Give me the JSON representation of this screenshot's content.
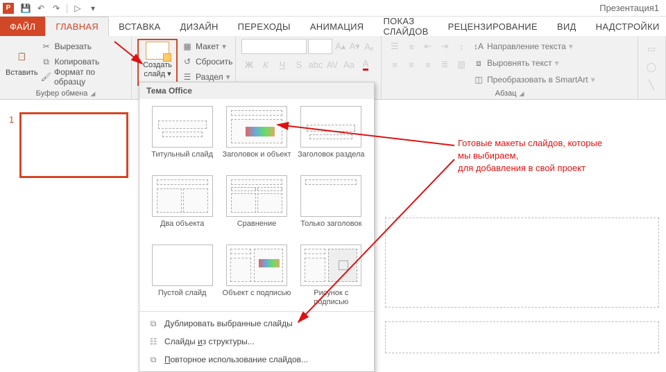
{
  "titlebar": {
    "doc_title": "Презентация1"
  },
  "tabs": {
    "file": "ФАЙЛ",
    "home": "ГЛАВНАЯ",
    "insert": "ВСТАВКА",
    "design": "ДИЗАЙН",
    "transitions": "ПЕРЕХОДЫ",
    "animation": "АНИМАЦИЯ",
    "slideshow": "ПОКАЗ СЛАЙДОВ",
    "review": "РЕЦЕНЗИРОВАНИЕ",
    "view": "ВИД",
    "addins": "НАДСТРОЙКИ"
  },
  "ribbon": {
    "clipboard": {
      "paste": "Вставить",
      "cut": "Вырезать",
      "copy": "Копировать",
      "format_painter": "Формат по образцу",
      "group_label": "Буфер обмена"
    },
    "slides": {
      "new_slide_line1": "Создать",
      "new_slide_line2": "слайд",
      "layout": "Макет",
      "reset": "Сбросить",
      "section": "Раздел"
    },
    "paragraph": {
      "group_label": "Абзац",
      "text_direction": "Направление текста",
      "align_text": "Выровнять текст",
      "convert_smartart": "Преобразовать в SmartArt"
    }
  },
  "dropdown": {
    "header": "Тема Office",
    "layouts": [
      "Титульный слайд",
      "Заголовок и объект",
      "Заголовок раздела",
      "Два объекта",
      "Сравнение",
      "Только заголовок",
      "Пустой слайд",
      "Объект с подписью",
      "Рисунок с подписью"
    ],
    "footer": {
      "duplicate": "Дублировать выбранные слайды",
      "outline": "Слайды из структуры...",
      "reuse": "Повторное использование слайдов..."
    }
  },
  "slide_pane": {
    "current_slide_number": "1"
  },
  "annotation": {
    "line1": "Готовые макеты слайдов, которые",
    "line2": "мы выбираем,",
    "line3": "для добавления в свой проект"
  }
}
